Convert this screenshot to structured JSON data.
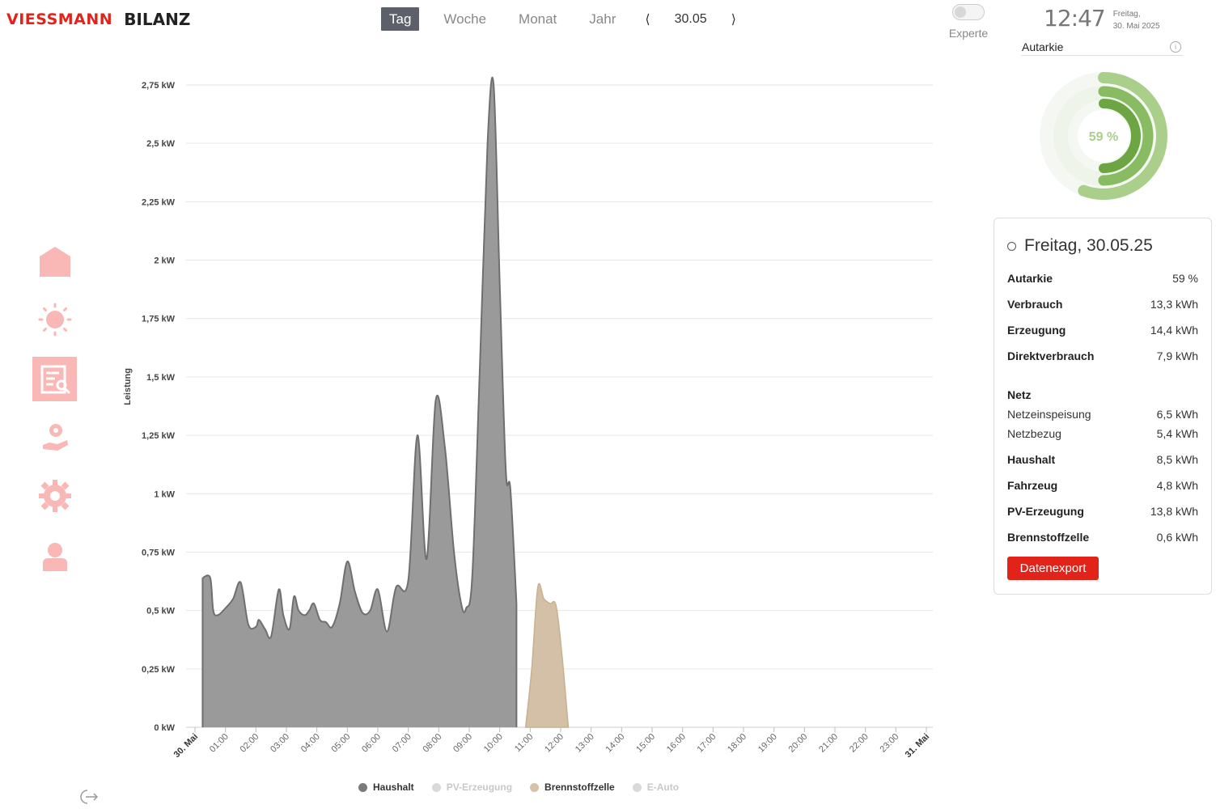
{
  "header": {
    "brand": "VIESSMANN",
    "title": "BILANZ",
    "tabs": [
      {
        "label": "Tag"
      },
      {
        "label": "Woche"
      },
      {
        "label": "Monat"
      },
      {
        "label": "Jahr"
      }
    ],
    "prev": "⟨",
    "next": "⟩",
    "date": "30.05",
    "experte_label": "Experte",
    "clock_time": "12:47",
    "clock_day": "Freitag,",
    "clock_date": "30. Mai 2025"
  },
  "autarkie": {
    "label": "Autarkie",
    "percent_text": "59 %",
    "percent": 59
  },
  "summary": {
    "date": "Freitag, 30.05.25",
    "rows": [
      {
        "k": "Autarkie",
        "v": "59 %"
      },
      {
        "k": "Verbrauch",
        "v": "13,3 kWh"
      },
      {
        "k": "Erzeugung",
        "v": "14,4 kWh"
      },
      {
        "k": "Direktverbrauch",
        "v": "7,9 kWh"
      },
      {
        "k": "Netz",
        "v": ""
      },
      {
        "k": "Netzeinspeisung",
        "v": "6,5 kWh"
      },
      {
        "k": "Netzbezug",
        "v": "5,4 kWh"
      },
      {
        "k": "Haushalt",
        "v": "8,5 kWh"
      },
      {
        "k": "Fahrzeug",
        "v": "4,8 kWh"
      },
      {
        "k": "PV-Erzeugung",
        "v": "13,8 kWh"
      },
      {
        "k": "Brennstoffzelle",
        "v": "0,6 kWh"
      }
    ],
    "export_label": "Datenexport"
  },
  "icons": {
    "sidebar": [
      "home-icon",
      "sun-icon",
      "report-icon",
      "hand-coin-icon",
      "gear-icon",
      "user-icon"
    ],
    "logout": "logout-icon"
  },
  "colors": {
    "brand": "#e2231a",
    "haushalt": "#8a8a8a",
    "brennstoffzelle": "#d7c2a8",
    "sidebar_icon": "#f9b7b5",
    "ring_outer": "#a9cf8a",
    "ring_mid": "#88bb62",
    "ring_inner": "#6ca542"
  },
  "chart_data": {
    "type": "area",
    "ylabel": "Leistung",
    "yticks": [
      "0 kW",
      "0,25 kW",
      "0,5 kW",
      "0,75 kW",
      "1 kW",
      "1,25 kW",
      "1,5 kW",
      "1,75 kW",
      "2 kW",
      "2,25 kW",
      "2,5 kW",
      "2,75 kW"
    ],
    "ylim": [
      0,
      2.75
    ],
    "xticks": [
      "30. Mai",
      "01:00",
      "02:00",
      "03:00",
      "04:00",
      "05:00",
      "06:00",
      "07:00",
      "08:00",
      "09:00",
      "10:00",
      "11:00",
      "12:00",
      "13:00",
      "14:00",
      "15:00",
      "16:00",
      "17:00",
      "18:00",
      "19:00",
      "20:00",
      "21:00",
      "22:00",
      "23:00",
      "31. Mai"
    ],
    "xlim_hours": [
      0,
      24
    ],
    "series": [
      {
        "name": "Haushalt",
        "hours": [
          0.25,
          0.5,
          0.6,
          0.75,
          1.0,
          1.25,
          1.5,
          1.75,
          2.0,
          2.1,
          2.3,
          2.5,
          2.75,
          2.9,
          3.1,
          3.25,
          3.4,
          3.6,
          3.75,
          3.9,
          4.1,
          4.3,
          4.5,
          4.75,
          5.0,
          5.25,
          5.5,
          5.75,
          6.0,
          6.3,
          6.6,
          7.0,
          7.3,
          7.6,
          7.9,
          8.2,
          8.5,
          8.75,
          8.9,
          9.1,
          9.35,
          9.6,
          9.8,
          10.0,
          10.2,
          10.35,
          10.55,
          10.8,
          11.0,
          11.15,
          11.3,
          11.45,
          11.6,
          11.72,
          11.82,
          11.95,
          12.1,
          12.25,
          12.5
        ],
        "values": [
          0.64,
          0.64,
          0.5,
          0.48,
          0.51,
          0.55,
          0.62,
          0.44,
          0.43,
          0.46,
          0.42,
          0.39,
          0.59,
          0.48,
          0.42,
          0.56,
          0.5,
          0.48,
          0.5,
          0.53,
          0.46,
          0.45,
          0.43,
          0.53,
          0.71,
          0.58,
          0.49,
          0.5,
          0.59,
          0.41,
          0.6,
          0.63,
          1.25,
          0.72,
          1.4,
          1.2,
          0.75,
          0.52,
          0.51,
          0.65,
          1.55,
          2.5,
          2.75,
          1.9,
          1.1,
          1.02,
          0.53
        ],
        "values_note": ""
      },
      {
        "name": "PV-Erzeugung",
        "hours": [],
        "values": []
      },
      {
        "name": "Brennstoffzelle",
        "hours": [
          10.85,
          11.05,
          11.25,
          11.45,
          11.65,
          11.85,
          12.05,
          12.25
        ],
        "values": [
          0.0,
          0.25,
          0.6,
          0.55,
          0.53,
          0.52,
          0.3,
          0.0
        ]
      },
      {
        "name": "E-Auto",
        "hours": [],
        "values": []
      }
    ],
    "legend": [
      {
        "label": "Haushalt",
        "color": "#7a7a7a",
        "active": true
      },
      {
        "label": "PV-Erzeugung",
        "color": "#d9d9d9",
        "active": false
      },
      {
        "label": "Brennstoffzelle",
        "color": "#d7c2a8",
        "active": true
      },
      {
        "label": "E-Auto",
        "color": "#d9d9d9",
        "active": false
      }
    ],
    "grid": true
  }
}
